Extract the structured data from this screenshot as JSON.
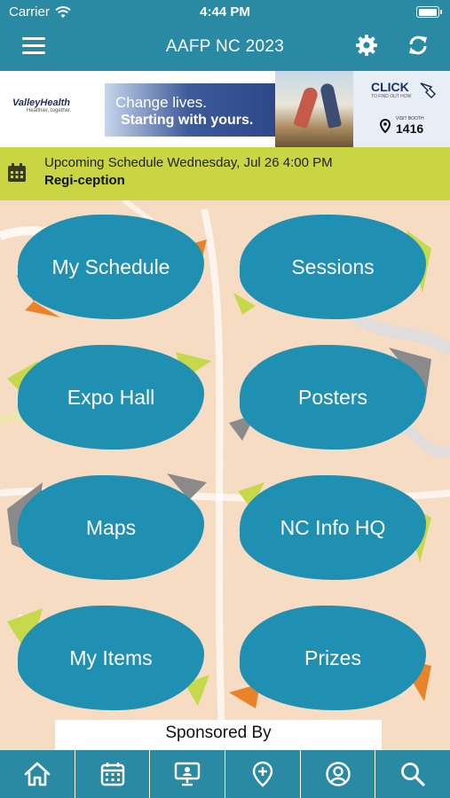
{
  "status_bar": {
    "carrier": "Carrier",
    "time": "4:44 PM",
    "battery_level": 1.0
  },
  "nav": {
    "title": "AAFP NC 2023",
    "menu_icon": "hamburger-icon",
    "settings_icon": "gear-icon",
    "refresh_icon": "refresh-icon"
  },
  "banner": {
    "brand": "ValleyHealth",
    "tagline": "Healthier, together.",
    "slogan_line1": "Change lives.",
    "slogan_line2": "Starting with yours.",
    "click_label": "CLICK",
    "click_sub": "TO FIND OUT HOW",
    "booth_label": "VISIT BOOTH",
    "booth_number": "1416"
  },
  "upcoming": {
    "label": "Upcoming Schedule Wednesday, Jul 26 4:00 PM",
    "event": "Regi-ception",
    "icon": "calendar-icon"
  },
  "tiles": [
    {
      "label": "My Schedule",
      "smear": "#e8832a"
    },
    {
      "label": "Sessions",
      "smear": "#c5d94a"
    },
    {
      "label": "Expo Hall",
      "smear": "#c5d94a"
    },
    {
      "label": "Posters",
      "smear": "#8a8a8a"
    },
    {
      "label": "Maps",
      "smear": "#8a8a8a"
    },
    {
      "label": "NC Info HQ",
      "smear": "#c5d94a"
    },
    {
      "label": "My Items",
      "smear": "#c5d94a"
    },
    {
      "label": "Prizes",
      "smear": "#e8832a"
    }
  ],
  "sponsor": {
    "label": "Sponsored By"
  },
  "tabbar": [
    "home-icon",
    "calendar-icon",
    "presentation-icon",
    "add-location-icon",
    "profile-icon",
    "search-icon"
  ],
  "colors": {
    "primary": "#2b8aa3",
    "tile_blue": "#1f8fb2",
    "accent_lime": "#c9d642",
    "background": "#f7dcc4"
  }
}
